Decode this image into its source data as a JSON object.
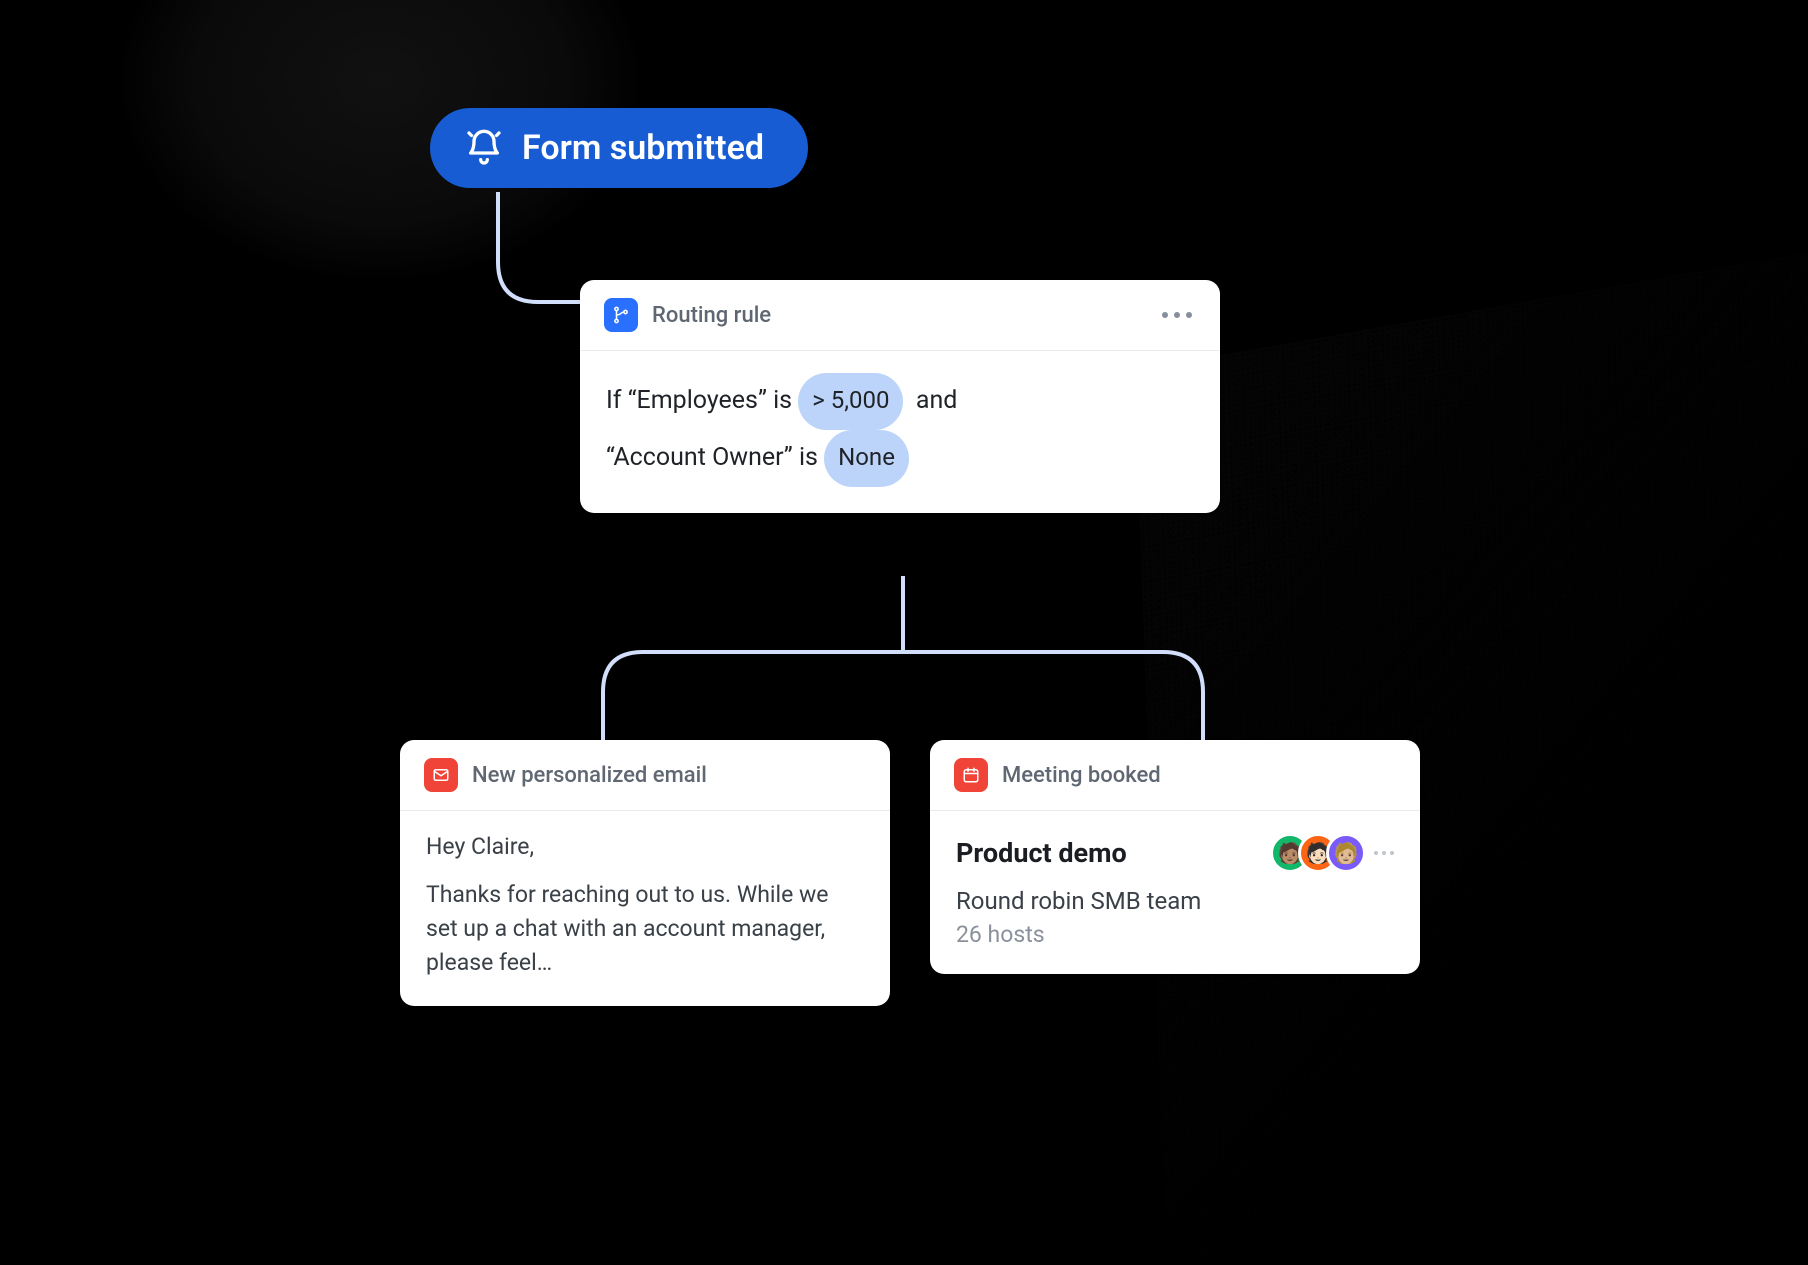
{
  "trigger": {
    "label": "Form submitted"
  },
  "routing": {
    "header": "Routing rule",
    "rule_plain": "If \"Employees\" is > 5,000 and \"Account Owner\" is None",
    "if": "If",
    "field1": "“Employees”",
    "is1": "is",
    "chip1": "> 5,000",
    "and": "and",
    "field2": "“Account Owner”",
    "is2": "is",
    "chip2": "None"
  },
  "email": {
    "header": "New personalized email",
    "greeting": "Hey Claire,",
    "body": "Thanks for reaching out to us. While we set up a chat with an account manager, please feel…"
  },
  "meeting": {
    "header": "Meeting booked",
    "title": "Product demo",
    "team": "Round robin SMB team",
    "hosts": "26 hosts",
    "avatar_emojis": [
      "🧑🏽",
      "🧑🏻",
      "🧑🏼"
    ]
  }
}
